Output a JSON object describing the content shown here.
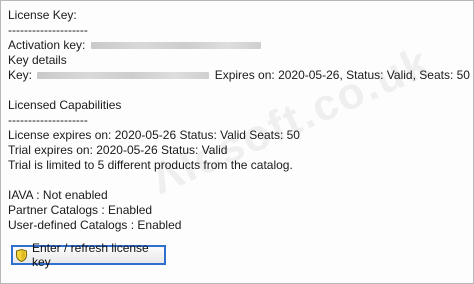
{
  "license": {
    "license_key_label": "License Key:",
    "separator1": "--------------------",
    "activation_key_label": "Activation key:",
    "key_details_label": "Key details",
    "key_label": "Key:",
    "key_details_text": "Expires on: 2020-05-26, Status: Valid, Seats: 50"
  },
  "capabilities": {
    "title": "Licensed Capabilities",
    "separator": "--------------------",
    "license_expires": "License expires on: 2020-05-26  Status: Valid  Seats: 50",
    "trial_expires": "Trial expires on: 2020-05-26  Status: Valid",
    "trial_limit": "Trial is limited to 5 different products from the catalog."
  },
  "features": {
    "iava": "IAVA : Not enabled",
    "partner": "Partner Catalogs : Enabled",
    "user_defined": "User-defined Catalogs : Enabled"
  },
  "actions": {
    "enter_refresh_label": "Enter / refresh license key",
    "enter_refresh_icon": "shield-icon",
    "focus_color": "#2f6fd0"
  }
}
